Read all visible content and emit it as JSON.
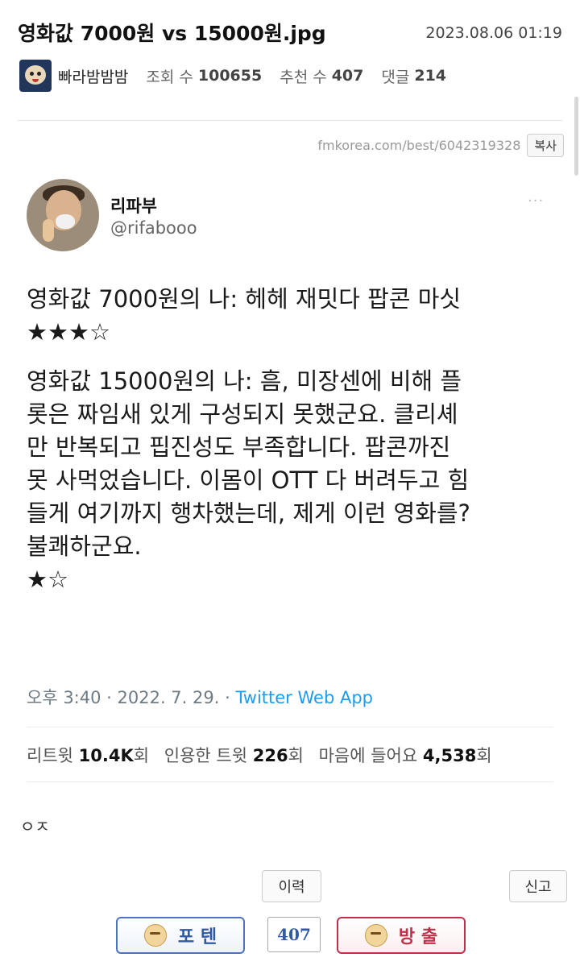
{
  "post": {
    "title": "영화값 7000원 vs 15000원.jpg",
    "datetime": "2023.08.06 01:19",
    "author": "빠라밤밤밤",
    "views_label": "조회 수",
    "views": "100655",
    "upvotes_label": "추천 수",
    "upvotes": "407",
    "comments_label": "댓글",
    "comments": "214",
    "source_url": "fmkorea.com/best/6042319328",
    "copy_label": "복사"
  },
  "tweet": {
    "name": "리파부",
    "handle": "@rifabooo",
    "more": "···",
    "line1": "영화값 7000원의 나: 헤헤 재밋다 팝콘 마싯\n★★★☆",
    "line2": "영화값 15000원의 나: 흠, 미장센에 비해 플\n롯은 짜임새 있게 구성되지 못했군요. 클리셰\n만 반복되고 핍진성도 부족합니다. 팝콘까진\n못 사먹었습니다. 이몸이 OTT 다 버려두고 힘\n들게 여기까지 행차했는데, 제게 이런 영화를?\n불쾌하군요.\n★☆",
    "time": "오후 3:40 · 2022. 7. 29. · ",
    "app": "Twitter Web App",
    "retweets_label": "리트윗",
    "retweets": "10.4K",
    "retweets_unit": "회",
    "quotes_label": "인용한 트윗",
    "quotes": "226",
    "quotes_unit": "회",
    "likes_label": "마음에 들어요",
    "likes": "4,538",
    "likes_unit": "회"
  },
  "comment": {
    "text": "ㅇㅈ"
  },
  "actions": {
    "history_label": "이력",
    "report_label": "신고",
    "upvote_label": "포 텐",
    "vote_count": "407",
    "downvote_label": "방 출"
  }
}
